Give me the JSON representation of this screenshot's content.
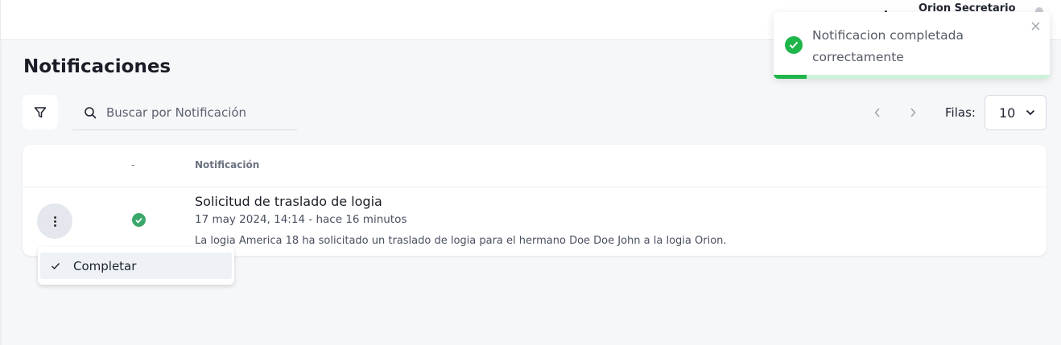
{
  "topbar": {
    "user_name": "Orion Secretario"
  },
  "page": {
    "title": "Notificaciones"
  },
  "toolbar": {
    "search_placeholder": "Buscar por Notificación",
    "rows_label": "Filas:",
    "rows_value": "10"
  },
  "table": {
    "headers": {
      "status": "-",
      "notification": "Notificación"
    },
    "rows": [
      {
        "title": "Solicitud de traslado de logia",
        "date": "17 may 2024, 14:14 - hace 16 minutos",
        "description": "La logia America 18 ha solicitado un traslado de logia para el hermano Doe Doe John a la logia Orion.",
        "status": "completed"
      }
    ]
  },
  "row_menu": {
    "items": [
      {
        "label": "Completar",
        "icon": "check-icon"
      }
    ]
  },
  "toast": {
    "message": "Notificacion completada correctamente",
    "type": "success",
    "progress": 0.12
  },
  "colors": {
    "success": "#1fb54a",
    "status_ok": "#3aa86a"
  }
}
